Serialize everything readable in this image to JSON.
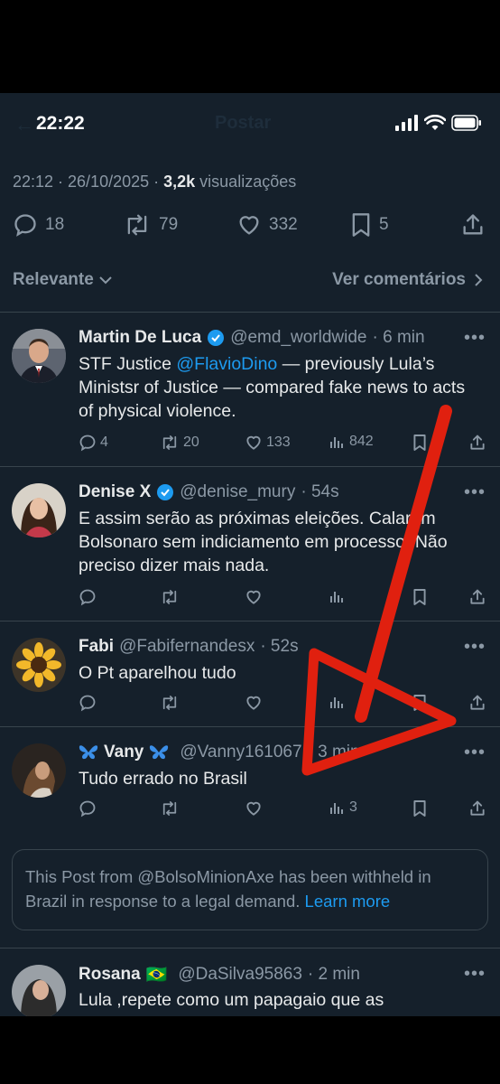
{
  "status_bar": {
    "time": "22:22"
  },
  "header": {
    "title": "Postar"
  },
  "tweet_meta": {
    "time_date": "22:12 · 26/10/2025 · ",
    "views_count": "3,2k",
    "views_label": " visualizações"
  },
  "stats": {
    "replies": "18",
    "reposts": "79",
    "likes": "332",
    "bookmarks": "5"
  },
  "sort": {
    "label": "Relevante",
    "comments_link": "Ver comentários"
  },
  "replies": [
    {
      "name": "Martin De Luca",
      "verified": true,
      "handle": "@emd_worldwide",
      "time": "· 6 min",
      "text_pre": "STF Justice ",
      "mention": "@FlavioDino",
      "text_post": " — previously Lula’s Ministsr of Justice — compared fake news to acts of physical violence.",
      "reply_count": "4",
      "repost_count": "20",
      "like_count": "133",
      "view_count": "842"
    },
    {
      "name": "Denise X",
      "verified": true,
      "handle": "@denise_mury",
      "time": "· 54s",
      "text": "E assim serão as próximas eleições. Calaram Bolsonaro sem indiciamento em processo.  Não preciso dizer mais nada."
    },
    {
      "name": "Fabi",
      "handle": "@Fabifernandesx",
      "time": "· 52s",
      "text": "O Pt  aparelhou tudo"
    },
    {
      "name": "Vany",
      "handle": "@Vanny161067",
      "time": "· 3 min",
      "text": "Tudo errado no Brasil",
      "view_count": "3"
    }
  ],
  "withheld_notice": {
    "text": "This Post from @BolsoMinionAxe has been withheld in Brazil in response to a legal demand. ",
    "link": "Learn more"
  },
  "last_reply": {
    "name": "Rosana",
    "flag": "🇧🇷",
    "handle": "@DaSilva95863",
    "time": "· 2 min",
    "text": "Lula ,repete como um papagaio que as"
  },
  "colors": {
    "background": "#15202b",
    "accent": "#1d9bf0",
    "muted": "#8b98a5",
    "annotation_arrow": "#e0200f"
  }
}
